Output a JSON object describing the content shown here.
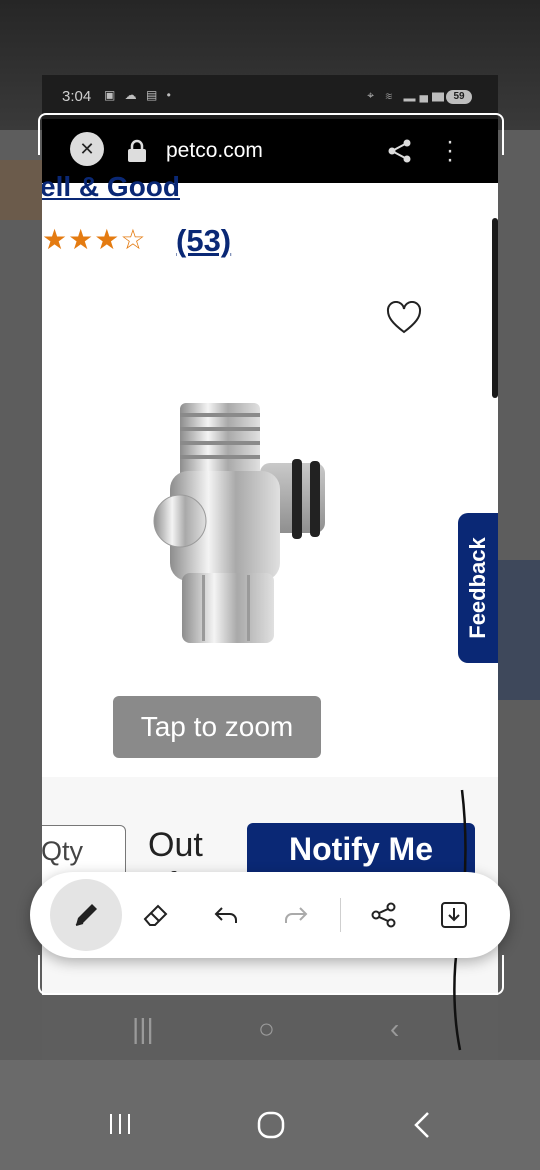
{
  "device_status": {
    "time": "3:04",
    "left_icons": "▣ ☁ ▤ •",
    "right_icons": "⌖ ≋ ▂▄▆",
    "battery": "59"
  },
  "browser": {
    "url": "petco.com",
    "close_icon": "close-icon",
    "lock_icon": "lock-icon",
    "share_icon": "share-icon",
    "more_icon": "more-vertical-icon"
  },
  "product": {
    "brand_partial": "ell & Good",
    "rating_stars_full": "★★★",
    "rating_stars_empty": "☆",
    "rating_value": 3,
    "review_count": "(53)",
    "zoom_label": "Tap to zoom",
    "feedback_label": "Feedback"
  },
  "purchase": {
    "qty_label": "Qty",
    "availability": "Out of",
    "notify_label": "Notify Me"
  },
  "toolbar": {
    "tools": [
      "pen",
      "eraser",
      "undo",
      "redo",
      "share",
      "save"
    ],
    "active_tool": "pen"
  },
  "colors": {
    "brand_navy": "#0a2875",
    "star_orange": "#e47b11",
    "zoom_grey": "#8a8a8a"
  }
}
